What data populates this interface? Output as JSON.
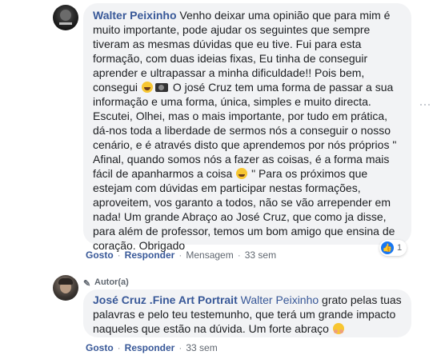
{
  "comment1": {
    "author": "Walter Peixinho",
    "text_part1": " Venho deixar uma opinião que para mim é muito importante, pode ajudar os seguintes que sempre tiveram as mesmas dúvidas que eu tive. Fui para esta formação, com duas ideias fixas, Eu tinha de conseguir aprender e ultrapassar a minha dificuldade!! Pois bem, consegui ",
    "text_part2": " O josé Cruz tem uma forma de passar a sua informação e uma forma, única, simples e muito directa. Escutei, Olhei, mas o mais importante, por tudo em prática, dá-nos toda a liberdade de sermos nós a conseguir o nosso cenário, e é através disto que aprendemos por nós próprios \" Afinal, quando somos nós a fazer as coisas, é a forma mais fácil de apanharmos a coisa ",
    "text_part3": " \" Para os próximos que estejam com dúvidas em participar nestas formações, aproveitem, vos garanto a todos, não se vão arrepender em nada! Um grande Abraço ao José Cruz, que como ja disse, para além de professor, temos um bom amigo que ensina de coração. Obrigado",
    "actions": {
      "like": "Gosto",
      "reply": "Responder",
      "message": "Mensagem",
      "time": "33 sem"
    },
    "reaction_count": "1",
    "icons": {
      "emoji1": "laughing-emoji-icon",
      "emoji2": "camera-icon",
      "emoji3": "wink-emoji-icon",
      "reaction": "like-reaction-icon"
    }
  },
  "comment2": {
    "badge": "Autor(a)",
    "author": "José Cruz .Fine Art Portrait",
    "mention": "Walter Peixinho",
    "text": " grato pelas tuas palavras e pelo teu testemunho, que terá um grande impacto naqueles que estão na dúvida. Um forte abraço ",
    "actions": {
      "like": "Gosto",
      "reply": "Responder",
      "time": "33 sem"
    },
    "icons": {
      "badge": "pencil-icon",
      "emoji": "hugging-emoji-icon"
    }
  },
  "colors": {
    "link": "#385898",
    "bubble": "#f2f3f5",
    "meta": "#606770",
    "like": "#1877f2"
  }
}
